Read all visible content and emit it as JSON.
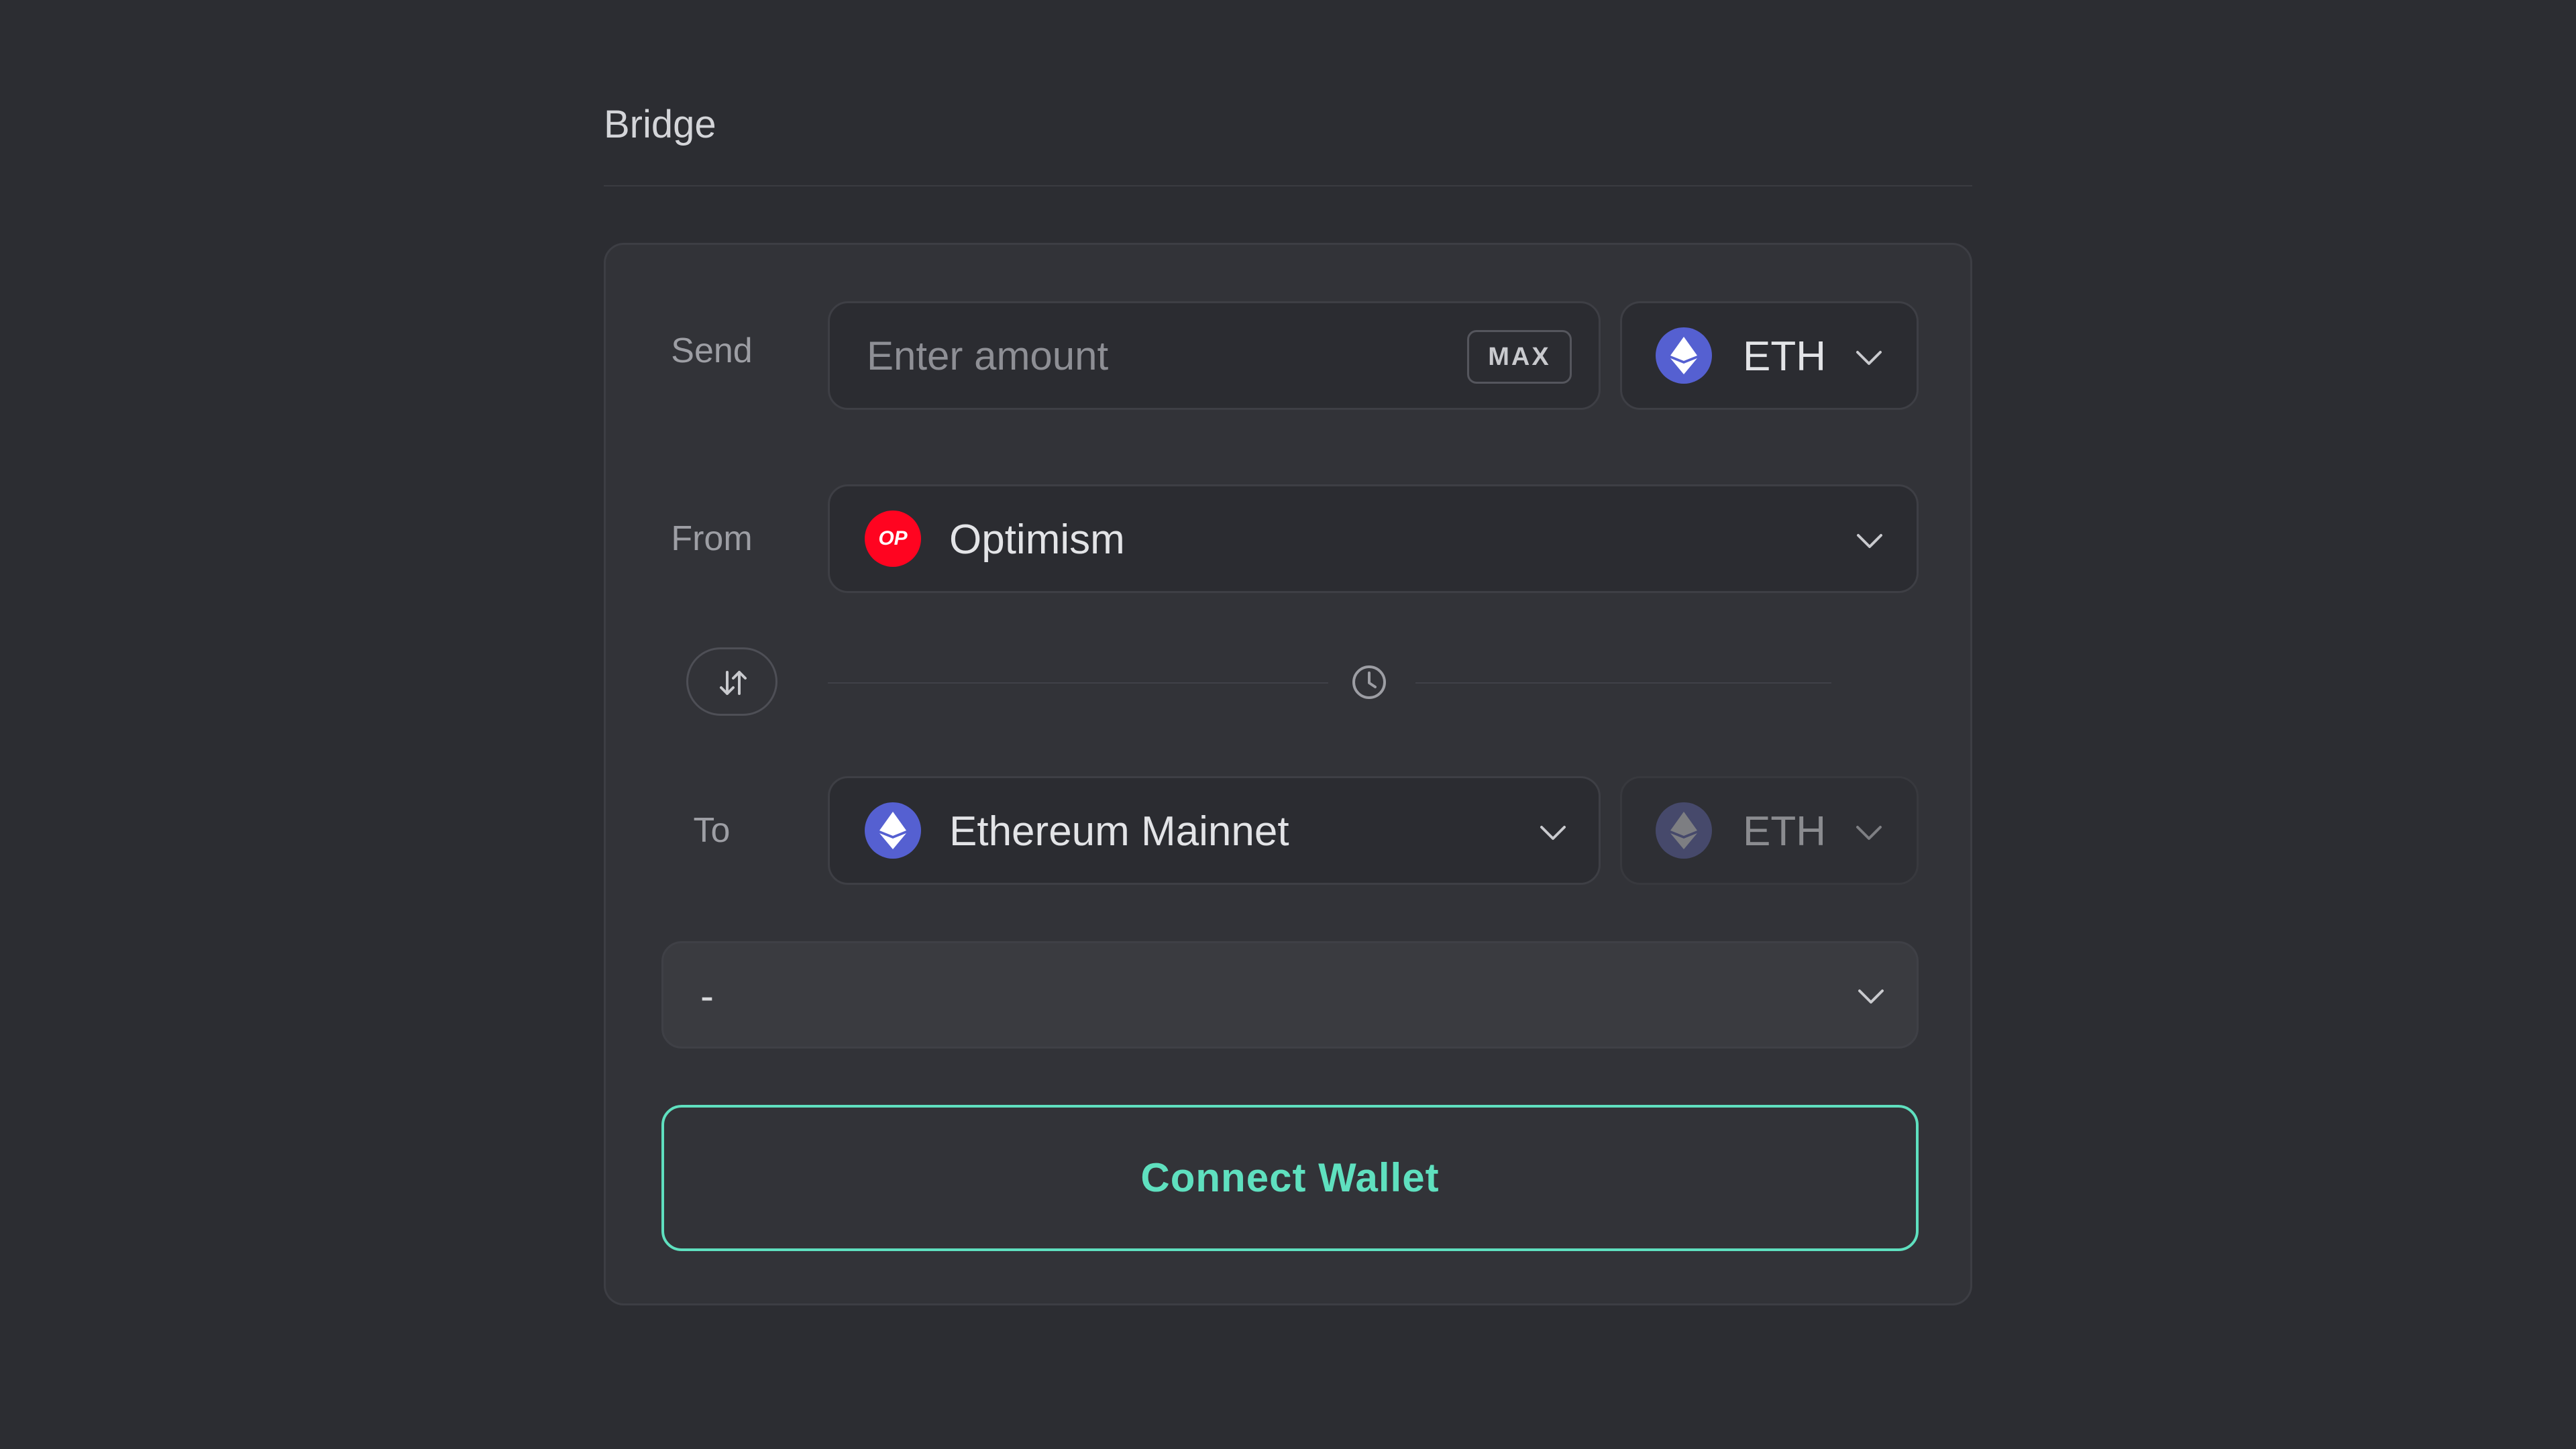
{
  "page": {
    "title": "Bridge"
  },
  "send": {
    "label": "Send",
    "amount_placeholder": "Enter amount",
    "max_label": "MAX",
    "token": {
      "symbol": "ETH",
      "icon": "eth-icon"
    }
  },
  "from": {
    "label": "From",
    "network": "Optimism",
    "network_icon": "optimism-icon",
    "network_badge": "OP"
  },
  "swap": {
    "icon": "swap-arrows-icon",
    "time_icon": "clock-icon"
  },
  "to": {
    "label": "To",
    "network": "Ethereum Mainnet",
    "network_icon": "eth-icon",
    "token": {
      "symbol": "ETH",
      "icon": "eth-icon",
      "disabled": true
    }
  },
  "route": {
    "value": "-"
  },
  "connect_wallet": {
    "label": "Connect Wallet"
  },
  "colors": {
    "background": "#2c2d32",
    "card": "#323338",
    "accent": "#5fe0bf",
    "eth": "#5560d1",
    "optimism": "#ff0420"
  }
}
